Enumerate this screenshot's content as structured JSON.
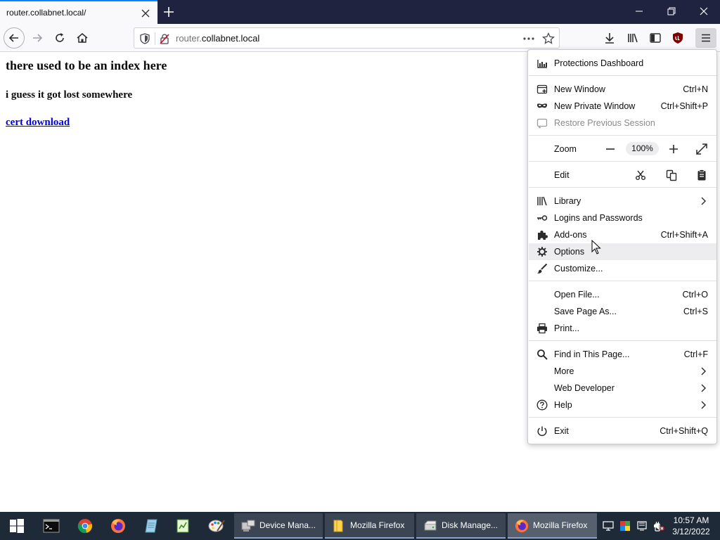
{
  "tab": {
    "title": "router.collabnet.local/"
  },
  "url": {
    "host_dim": "router.",
    "host_main": "collabnet.local"
  },
  "page": {
    "heading": "there used to be an index here",
    "subheading": "i guess it got lost somewhere",
    "link": "cert download"
  },
  "menu": {
    "protections": "Protections Dashboard",
    "new_window": {
      "label": "New Window",
      "shortcut": "Ctrl+N"
    },
    "new_private": {
      "label": "New Private Window",
      "shortcut": "Ctrl+Shift+P"
    },
    "restore": "Restore Previous Session",
    "zoom": {
      "label": "Zoom",
      "value": "100%"
    },
    "edit": "Edit",
    "library": "Library",
    "logins": "Logins and Passwords",
    "addons": {
      "label": "Add-ons",
      "shortcut": "Ctrl+Shift+A"
    },
    "options": "Options",
    "customize": "Customize...",
    "open_file": {
      "label": "Open File...",
      "shortcut": "Ctrl+O"
    },
    "save_page": {
      "label": "Save Page As...",
      "shortcut": "Ctrl+S"
    },
    "print": "Print...",
    "find": {
      "label": "Find in This Page...",
      "shortcut": "Ctrl+F"
    },
    "more": "More",
    "web_dev": "Web Developer",
    "help": "Help",
    "exit": {
      "label": "Exit",
      "shortcut": "Ctrl+Shift+Q"
    }
  },
  "taskbar": {
    "apps": [
      {
        "label": "Device Mana...",
        "icon": "device-manager-icon"
      },
      {
        "label": "Mozilla Firefox",
        "icon": "folder-icon"
      },
      {
        "label": "Disk Manage...",
        "icon": "disk-manager-icon"
      },
      {
        "label": "Mozilla Firefox",
        "icon": "firefox-icon"
      }
    ],
    "time": "10:57 AM",
    "date": "3/12/2022"
  },
  "colors": {
    "tab_accent": "#0a84ff",
    "titlebar": "#202340",
    "link": "#0000ee",
    "taskbar": "#1f2a38"
  }
}
